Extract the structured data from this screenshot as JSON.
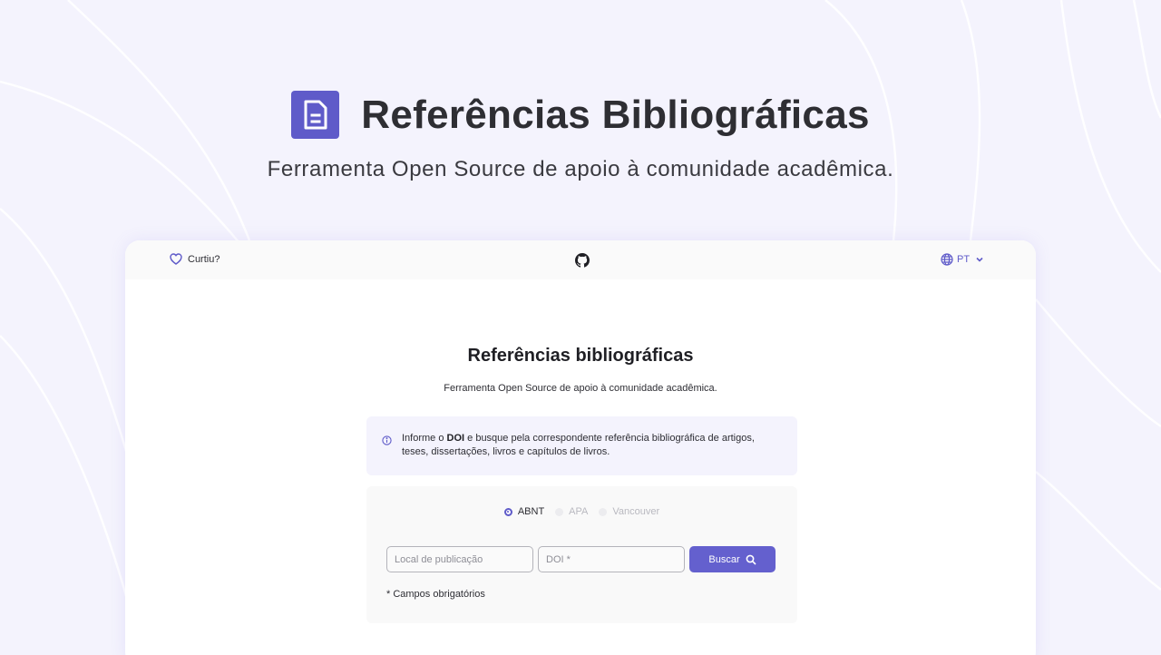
{
  "hero": {
    "title": "Referências Bibliográficas",
    "subtitle": "Ferramenta Open Source de apoio à comunidade acadêmica."
  },
  "topbar": {
    "like_label": "Curtiu?",
    "language": "PT"
  },
  "app": {
    "title": "Referências bibliográficas",
    "subtitle": "Ferramenta Open Source de apoio à comunidade acadêmica."
  },
  "info": {
    "text_before": "Informe o ",
    "text_bold": "DOI",
    "text_after": " e busque pela correspondente referência bibliográfica de artigos, teses, dissertações, livros e capítulos de livros."
  },
  "form": {
    "styles": [
      {
        "label": "ABNT",
        "selected": true
      },
      {
        "label": "APA",
        "selected": false
      },
      {
        "label": "Vancouver",
        "selected": false
      }
    ],
    "local_placeholder": "Local de publicação",
    "local_value": "",
    "doi_placeholder": "DOI *",
    "doi_value": "",
    "submit_label": "Buscar",
    "required_note": "* Campos obrigatórios"
  },
  "colors": {
    "accent": "#5f5bc9",
    "background": "#f4f3fd",
    "button": "#6460ce"
  },
  "icons": {
    "logo": "document-icon",
    "like": "heart-icon",
    "repo": "github-icon",
    "language": "globe-icon",
    "dropdown": "chevron-down-icon",
    "info": "info-circle-icon",
    "search": "search-icon"
  }
}
